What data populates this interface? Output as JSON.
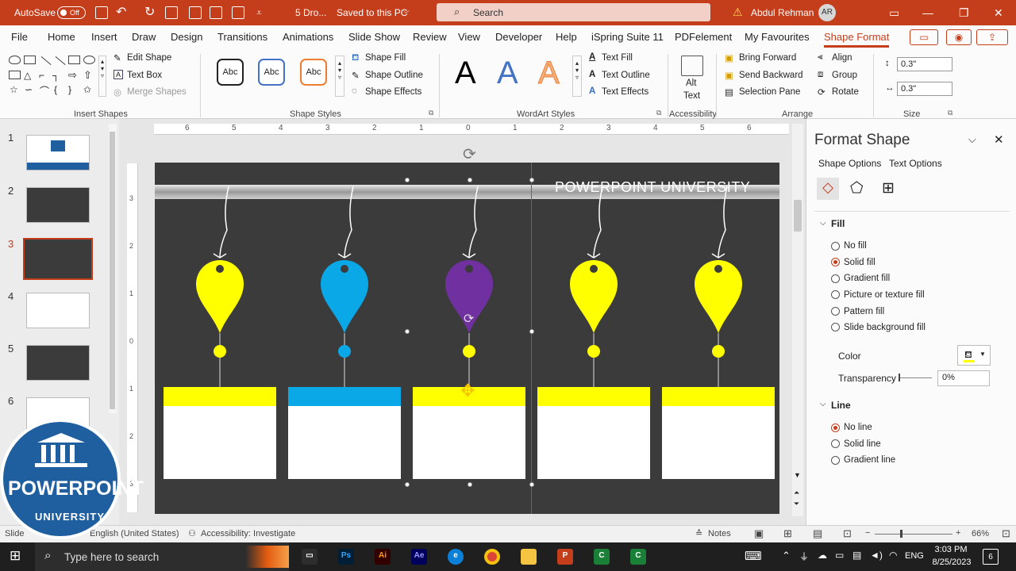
{
  "titlebar": {
    "autosave_label": "AutoSave",
    "autosave_state": "Off",
    "filename": "5 Dro...",
    "save_status": "Saved to this PC",
    "search_placeholder": "Search",
    "user_name": "Abdul Rehman",
    "user_initials": "AR"
  },
  "tabs": [
    "File",
    "Home",
    "Insert",
    "Draw",
    "Design",
    "Transitions",
    "Animations",
    "Slide Show",
    "Review",
    "View",
    "Developer",
    "Help",
    "iSpring Suite 11",
    "PDFelement",
    "My Favourites",
    "Shape Format"
  ],
  "active_tab": "Shape Format",
  "ribbon": {
    "insert_shapes": {
      "edit_shape": "Edit Shape",
      "text_box": "Text Box",
      "merge_shapes": "Merge Shapes",
      "group_label": "Insert Shapes"
    },
    "shape_styles": {
      "style_labels": [
        "Abc",
        "Abc",
        "Abc"
      ],
      "shape_fill": "Shape Fill",
      "shape_outline": "Shape Outline",
      "shape_effects": "Shape Effects",
      "group_label": "Shape Styles"
    },
    "wordart": {
      "letters": [
        "A",
        "A",
        "A"
      ],
      "text_fill": "Text Fill",
      "text_outline": "Text Outline",
      "text_effects": "Text Effects",
      "group_label": "WordArt Styles"
    },
    "accessibility": {
      "alt_text_1": "Alt",
      "alt_text_2": "Text",
      "group_label": "Accessibility"
    },
    "arrange": {
      "bring_forward": "Bring Forward",
      "send_backward": "Send Backward",
      "selection_pane": "Selection Pane",
      "align": "Align",
      "group": "Group",
      "rotate": "Rotate",
      "group_label": "Arrange"
    },
    "size": {
      "height": "0.3\"",
      "width": "0.3\"",
      "group_label": "Size"
    }
  },
  "slides": [
    {
      "num": "1",
      "selected": false
    },
    {
      "num": "2",
      "selected": false
    },
    {
      "num": "3",
      "selected": true
    },
    {
      "num": "4",
      "selected": false
    },
    {
      "num": "5",
      "selected": false
    },
    {
      "num": "6",
      "selected": false
    }
  ],
  "ruler": {
    "top_labels": [
      "6",
      "5",
      "4",
      "3",
      "2",
      "1",
      "0",
      "1",
      "2",
      "3",
      "4",
      "5",
      "6"
    ],
    "left_labels": [
      "3",
      "2",
      "1",
      "0",
      "1",
      "2",
      "3"
    ]
  },
  "slide": {
    "title_text": "POWERPOINT UNIVERSITY",
    "drops": [
      {
        "color": "#ffff00"
      },
      {
        "color": "#0ba8e8"
      },
      {
        "color": "#7030a0"
      },
      {
        "color": "#ffff00"
      },
      {
        "color": "#ffff00"
      }
    ]
  },
  "format_pane": {
    "title": "Format Shape",
    "tab_shape_options": "Shape Options",
    "tab_text_options": "Text Options",
    "fill_section": "Fill",
    "fill_options": [
      "No fill",
      "Solid fill",
      "Gradient fill",
      "Picture or texture fill",
      "Pattern fill",
      "Slide background fill"
    ],
    "fill_selected": "Solid fill",
    "color_label": "Color",
    "transparency_label": "Transparency",
    "transparency_value": "0%",
    "line_section": "Line",
    "line_options": [
      "No line",
      "Solid line",
      "Gradient line"
    ],
    "line_selected": "No line"
  },
  "status": {
    "slide": "Slide",
    "language": "English (United States)",
    "accessibility": "Accessibility: Investigate",
    "notes": "Notes",
    "zoom": "66%"
  },
  "taskbar": {
    "search_placeholder": "Type here to search",
    "lang": "ENG",
    "time": "3:03 PM",
    "date": "8/25/2023",
    "notif_count": "6"
  },
  "logo": {
    "line1": "POWERPOINT",
    "line2": "UNIVERSITY"
  },
  "colors": {
    "accent": "#c43e1c",
    "slide_bg": "#3b3b3b",
    "yellow": "#ffff00",
    "blue": "#0ba8e8",
    "purple": "#7030a0"
  }
}
